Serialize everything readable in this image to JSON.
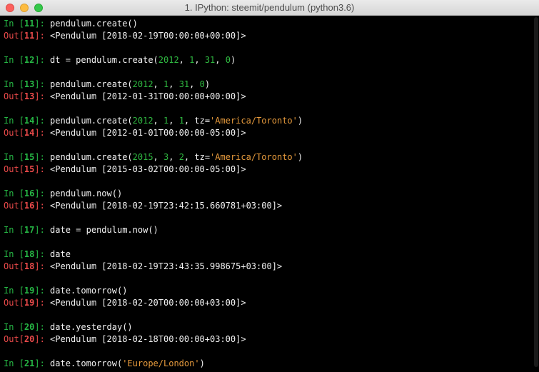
{
  "window": {
    "title": "1. IPython: steemit/pendulum (python3.6)"
  },
  "colors": {
    "background": "#000000",
    "text": "#f2f2f2",
    "in_prompt": "#26b845",
    "out_prompt": "#ea4a4a",
    "number": "#2fb941",
    "string": "#e69a3c"
  },
  "cells": [
    {
      "in_num": "11",
      "input": [
        {
          "t": "pendulum.create()"
        }
      ],
      "out_num": "11",
      "output": "<Pendulum [2018-02-19T00:00:00+00:00]>"
    },
    {
      "in_num": "12",
      "input": [
        {
          "t": "dt = pendulum.create("
        },
        {
          "t": "2012",
          "k": "num"
        },
        {
          "t": ", "
        },
        {
          "t": "1",
          "k": "num"
        },
        {
          "t": ", "
        },
        {
          "t": "31",
          "k": "num"
        },
        {
          "t": ", "
        },
        {
          "t": "0",
          "k": "num"
        },
        {
          "t": ")"
        }
      ]
    },
    {
      "in_num": "13",
      "input": [
        {
          "t": "pendulum.create("
        },
        {
          "t": "2012",
          "k": "num"
        },
        {
          "t": ", "
        },
        {
          "t": "1",
          "k": "num"
        },
        {
          "t": ", "
        },
        {
          "t": "31",
          "k": "num"
        },
        {
          "t": ", "
        },
        {
          "t": "0",
          "k": "num"
        },
        {
          "t": ")"
        }
      ],
      "out_num": "13",
      "output": "<Pendulum [2012-01-31T00:00:00+00:00]>"
    },
    {
      "in_num": "14",
      "input": [
        {
          "t": "pendulum.create("
        },
        {
          "t": "2012",
          "k": "num"
        },
        {
          "t": ", "
        },
        {
          "t": "1",
          "k": "num"
        },
        {
          "t": ", "
        },
        {
          "t": "1",
          "k": "num"
        },
        {
          "t": ", tz="
        },
        {
          "t": "'America/Toronto'",
          "k": "str"
        },
        {
          "t": ")"
        }
      ],
      "out_num": "14",
      "output": "<Pendulum [2012-01-01T00:00:00-05:00]>"
    },
    {
      "in_num": "15",
      "input": [
        {
          "t": "pendulum.create("
        },
        {
          "t": "2015",
          "k": "num"
        },
        {
          "t": ", "
        },
        {
          "t": "3",
          "k": "num"
        },
        {
          "t": ", "
        },
        {
          "t": "2",
          "k": "num"
        },
        {
          "t": ", tz="
        },
        {
          "t": "'America/Toronto'",
          "k": "str"
        },
        {
          "t": ")"
        }
      ],
      "out_num": "15",
      "output": "<Pendulum [2015-03-02T00:00:00-05:00]>"
    },
    {
      "in_num": "16",
      "input": [
        {
          "t": "pendulum.now()"
        }
      ],
      "out_num": "16",
      "output": "<Pendulum [2018-02-19T23:42:15.660781+03:00]>"
    },
    {
      "in_num": "17",
      "input": [
        {
          "t": "date = pendulum.now()"
        }
      ]
    },
    {
      "in_num": "18",
      "input": [
        {
          "t": "date"
        }
      ],
      "out_num": "18",
      "output": "<Pendulum [2018-02-19T23:43:35.998675+03:00]>"
    },
    {
      "in_num": "19",
      "input": [
        {
          "t": "date.tomorrow()"
        }
      ],
      "out_num": "19",
      "output": "<Pendulum [2018-02-20T00:00:00+03:00]>"
    },
    {
      "in_num": "20",
      "input": [
        {
          "t": "date.yesterday()"
        }
      ],
      "out_num": "20",
      "output": "<Pendulum [2018-02-18T00:00:00+03:00]>"
    },
    {
      "in_num": "21",
      "input": [
        {
          "t": "date.tomorrow("
        },
        {
          "t": "'Europe/London'",
          "k": "str"
        },
        {
          "t": ")"
        }
      ]
    }
  ]
}
